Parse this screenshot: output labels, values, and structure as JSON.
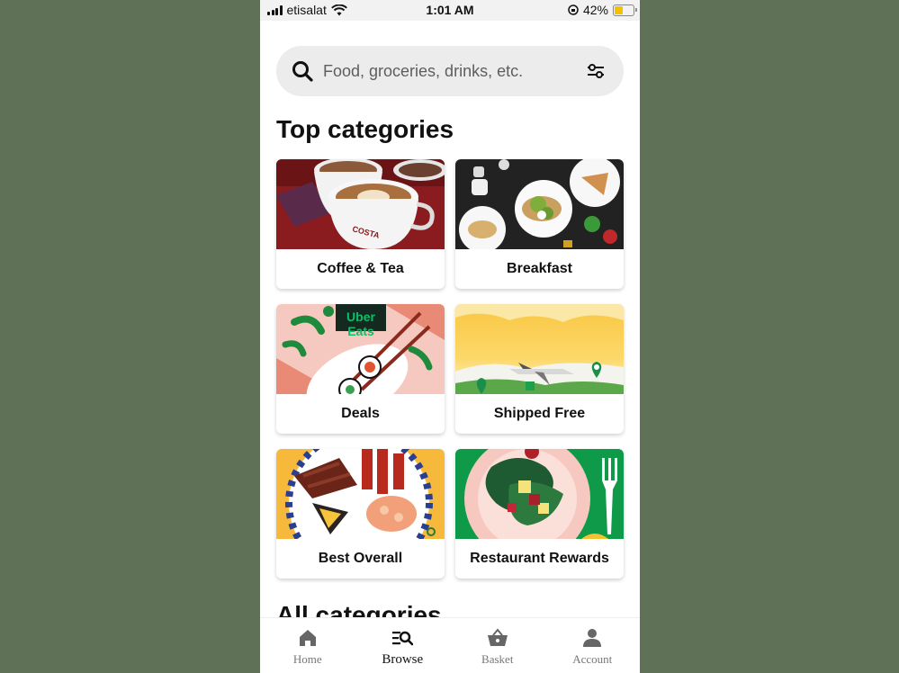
{
  "status_bar": {
    "carrier": "etisalat",
    "time": "1:01 AM",
    "battery": "42%",
    "battery_level": 0.42
  },
  "search": {
    "placeholder": "Food, groceries, drinks, etc."
  },
  "top_categories": {
    "title": "Top categories",
    "items": [
      {
        "label": "Coffee & Tea"
      },
      {
        "label": "Breakfast"
      },
      {
        "label": "Deals",
        "image_text": "Uber Eats"
      },
      {
        "label": "Shipped Free"
      },
      {
        "label": "Best Overall"
      },
      {
        "label": "Restaurant Rewards"
      }
    ]
  },
  "all_categories": {
    "title": "All categories"
  },
  "tabbar": {
    "tabs": [
      {
        "label": "Home",
        "icon": "home-icon"
      },
      {
        "label": "Browse",
        "icon": "browse-icon",
        "active": true
      },
      {
        "label": "Basket",
        "icon": "basket-icon"
      },
      {
        "label": "Account",
        "icon": "account-icon"
      }
    ]
  },
  "colors": {
    "background": "#5f7257",
    "accent_green": "#06a05a"
  }
}
